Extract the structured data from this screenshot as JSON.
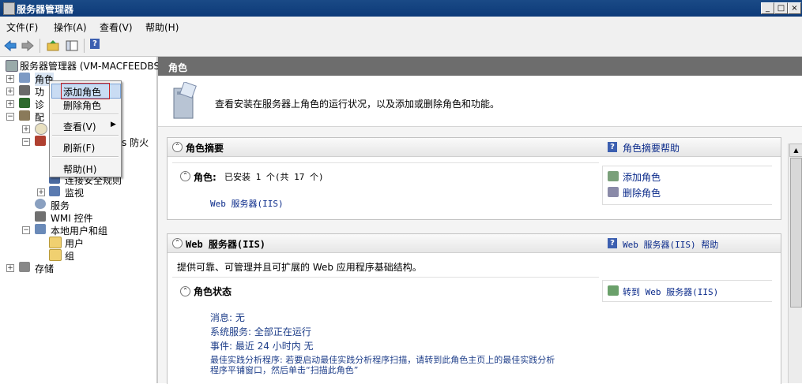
{
  "window": {
    "title": "服务器管理器",
    "controls": [
      "_",
      "□",
      "×"
    ]
  },
  "menubar": [
    "文件(F)",
    "操作(A)",
    "查看(V)",
    "帮助(H)"
  ],
  "tree": {
    "root": "服务器管理器 (VM-MACFEEDBSJ)",
    "roles": "角色",
    "features": "功",
    "diagnostics": "诊",
    "config": "配",
    "firewall_suffix": "s 防火",
    "conn_rules": "连接安全规则",
    "monitor": "监视",
    "services": "服务",
    "wmi": "WMI 控件",
    "local_users_groups": "本地用户和组",
    "users": "用户",
    "groups": "组",
    "storage": "存储"
  },
  "context_menu": {
    "add_role": "添加角色",
    "remove_role": "删除角色",
    "view": "查看(V)",
    "refresh": "刷新(F)",
    "help": "帮助(H)"
  },
  "right": {
    "header": "角色",
    "intro": "查看安装在服务器上角色的运行状况，以及添加或删除角色和功能。",
    "summary": {
      "title": "角色摘要",
      "help": "角色摘要帮助",
      "roles_label": "角色:",
      "roles_count": "已安装 1 个(共 17 个)",
      "role_link": "Web 服务器(IIS)",
      "add_roles": "添加角色",
      "remove_roles": "删除角色"
    },
    "web": {
      "title": "Web 服务器(IIS)",
      "help": "Web 服务器(IIS) 帮助",
      "desc": "提供可靠、可管理并且可扩展的 Web 应用程序基础结构。",
      "status_title": "角色状态",
      "goto": "转到 Web 服务器(IIS)",
      "messages": "消息: 无",
      "system_services": "系统服务: 全部正在运行",
      "events": "事件: 最近 24 小时内 无",
      "bpa_line1": "最佳实践分析程序: 若要启动最佳实践分析程序扫描，请转到此角色主页上的最佳实践分析",
      "bpa_line2": "程序平铺窗口，然后单击“扫描此角色”"
    }
  }
}
